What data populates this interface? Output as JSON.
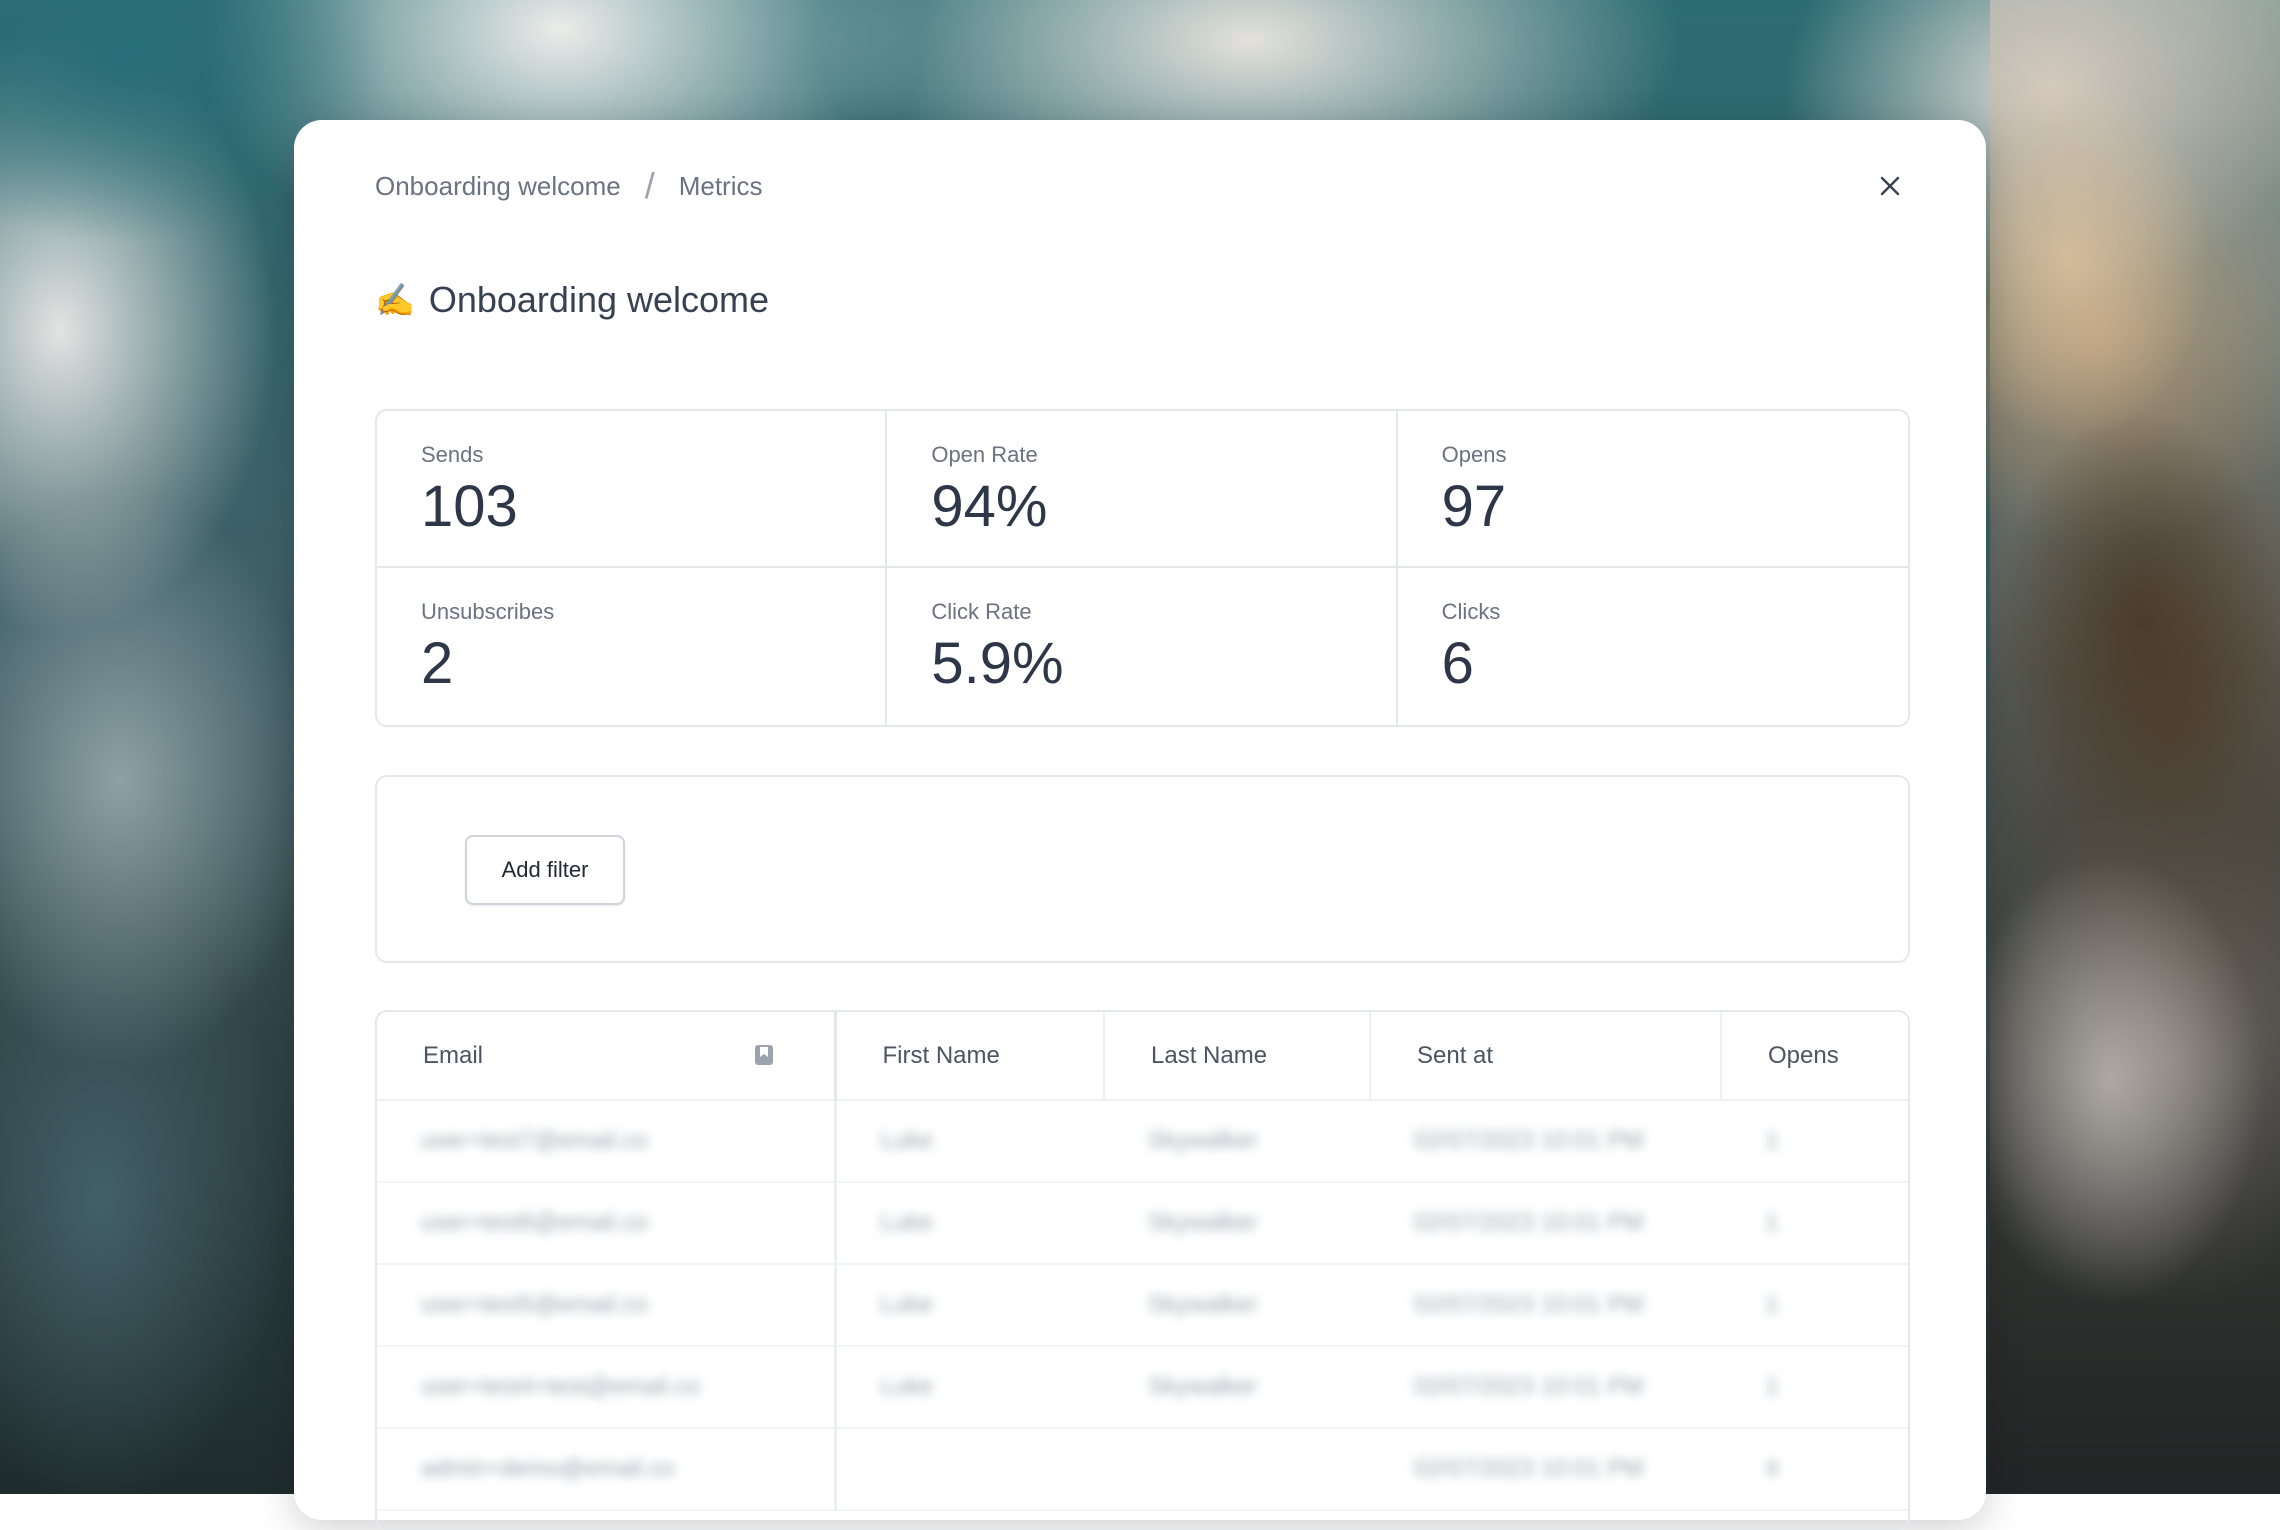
{
  "breadcrumb": {
    "parent": "Onboarding welcome",
    "separator": "/",
    "current": "Metrics"
  },
  "title": {
    "emoji": "✍️",
    "text": "Onboarding welcome"
  },
  "stats": [
    {
      "label": "Sends",
      "value": "103"
    },
    {
      "label": "Open Rate",
      "value": "94%"
    },
    {
      "label": "Opens",
      "value": "97"
    },
    {
      "label": "Unsubscribes",
      "value": "2"
    },
    {
      "label": "Click Rate",
      "value": "5.9%"
    },
    {
      "label": "Clicks",
      "value": "6"
    }
  ],
  "filter": {
    "add_label": "Add filter"
  },
  "table": {
    "columns": [
      "Email",
      "First Name",
      "Last Name",
      "Sent at",
      "Opens"
    ],
    "rows": [
      [
        "user+test7@email.co",
        "Luke",
        "Skywalker",
        "02/07/2023 10:01 PM",
        "1"
      ],
      [
        "user+test6@email.co",
        "Luke",
        "Skywalker",
        "02/07/2023 10:01 PM",
        "1"
      ],
      [
        "user+test5@email.co",
        "Luke",
        "Skywalker",
        "02/07/2023 10:01 PM",
        "1"
      ],
      [
        "user+test4+test@email.co",
        "Luke",
        "Skywalker",
        "02/07/2023 10:01 PM",
        "1"
      ],
      [
        "admin+demo@email.co",
        "",
        "",
        "02/07/2023 10:01 PM",
        "4"
      ]
    ]
  },
  "colors": {
    "text_primary": "#374151",
    "text_muted": "#6b7280",
    "border": "#e5e7eb"
  }
}
